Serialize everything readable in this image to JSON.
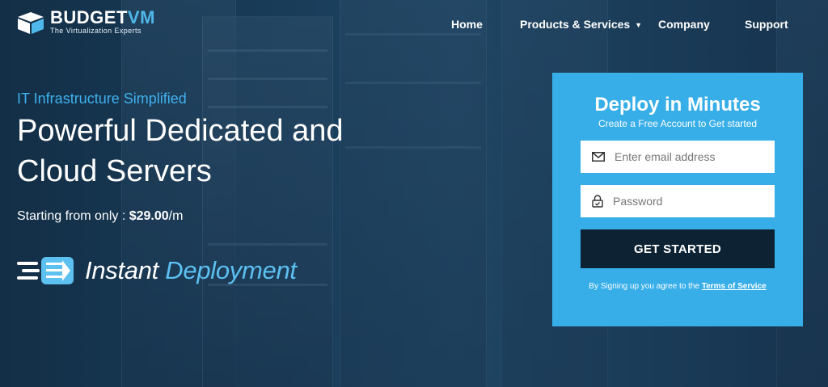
{
  "brand": {
    "name_main": "BUDGET",
    "name_accent": "VM",
    "tagline": "The Virtualization Experts"
  },
  "nav": {
    "items": [
      {
        "label": "Home"
      },
      {
        "label": "Products & Services"
      },
      {
        "label": "Company"
      },
      {
        "label": "Support"
      }
    ]
  },
  "hero": {
    "kicker": "IT Infrastructure Simplified",
    "headline_line1": "Powerful Dedicated and",
    "headline_line2": "Cloud Servers",
    "price_prefix": "Starting from only : ",
    "price_value": "$29.00",
    "price_suffix": "/m",
    "instant_word1": "Instant",
    "instant_word2": "Deployment"
  },
  "signup": {
    "title": "Deploy in Minutes",
    "subtitle": "Create a Free Account to Get started",
    "email_placeholder": "Enter email address",
    "password_placeholder": "Password",
    "button_label": "GET STARTED",
    "terms_prefix": "By Signing up you agree to the ",
    "terms_link": "Terms of Service"
  },
  "colors": {
    "accent": "#37aee8",
    "button_dark": "#0d2233",
    "kicker": "#3fb1ee"
  },
  "icons": {
    "email": "envelope-icon",
    "password": "lock-icon",
    "dropdown": "chevron-down-icon",
    "instant": "speed-arrow-icon"
  }
}
